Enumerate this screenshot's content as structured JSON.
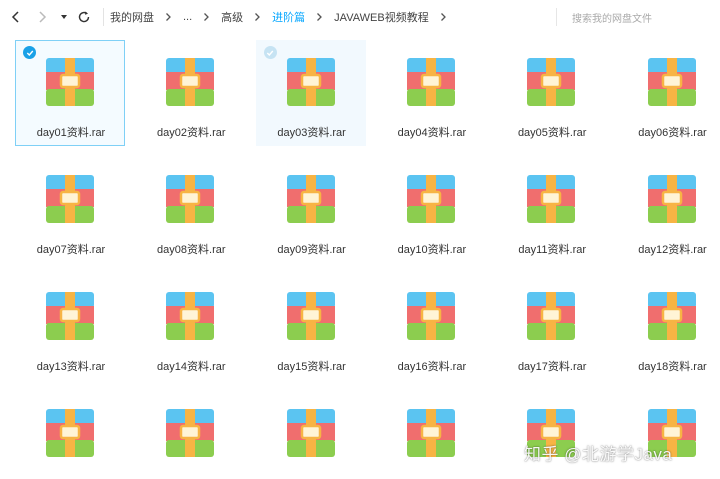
{
  "breadcrumb": {
    "items": [
      "我的网盘",
      "...",
      "高级",
      "进阶篇",
      "JAVAWEB视频教程"
    ],
    "active_index": 3
  },
  "search": {
    "placeholder": "搜索我的网盘文件"
  },
  "files": [
    {
      "name": "day01资料.rar",
      "state": "selected"
    },
    {
      "name": "day02资料.rar",
      "state": ""
    },
    {
      "name": "day03资料.rar",
      "state": "hovered"
    },
    {
      "name": "day04资料.rar",
      "state": ""
    },
    {
      "name": "day05资料.rar",
      "state": ""
    },
    {
      "name": "day06资料.rar",
      "state": ""
    },
    {
      "name": "day07资料.rar",
      "state": ""
    },
    {
      "name": "day08资料.rar",
      "state": ""
    },
    {
      "name": "day09资料.rar",
      "state": ""
    },
    {
      "name": "day10资料.rar",
      "state": ""
    },
    {
      "name": "day11资料.rar",
      "state": ""
    },
    {
      "name": "day12资料.rar",
      "state": ""
    },
    {
      "name": "day13资料.rar",
      "state": ""
    },
    {
      "name": "day14资料.rar",
      "state": ""
    },
    {
      "name": "day15资料.rar",
      "state": ""
    },
    {
      "name": "day16资料.rar",
      "state": ""
    },
    {
      "name": "day17资料.rar",
      "state": ""
    },
    {
      "name": "day18资料.rar",
      "state": ""
    },
    {
      "name": "",
      "state": ""
    },
    {
      "name": "",
      "state": ""
    },
    {
      "name": "",
      "state": ""
    },
    {
      "name": "",
      "state": ""
    },
    {
      "name": "",
      "state": ""
    },
    {
      "name": "",
      "state": ""
    }
  ],
  "icon": "rar-archive-icon",
  "colors": {
    "accent": "#06a7ff",
    "rar_blue": "#5bc4f1",
    "rar_red": "#f06e6e",
    "rar_green": "#8ccd4f",
    "rar_band": "#f7b444"
  },
  "watermark": "知乎 @北游学Java"
}
